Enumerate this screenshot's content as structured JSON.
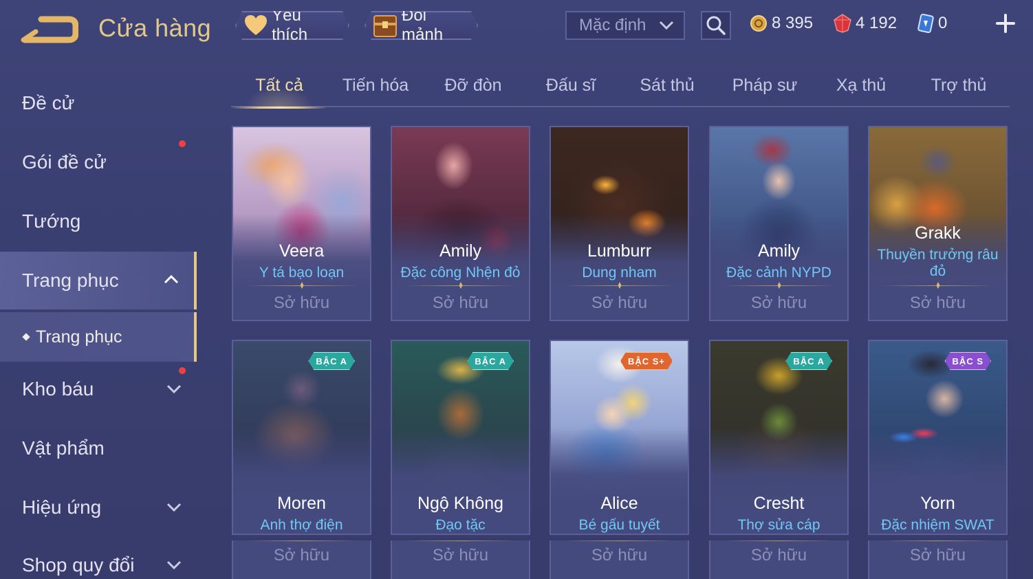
{
  "header": {
    "title": "Cửa hàng",
    "favorites_label": "Yêu thích",
    "exchange_label": "Đổi mảnh",
    "sort_selected": "Mặc định",
    "gold": "8 395",
    "gems": "4 192",
    "vouchers": "0"
  },
  "sidebar": {
    "items": [
      {
        "label": "Đề cử"
      },
      {
        "label": "Gói đề cử"
      },
      {
        "label": "Tướng"
      },
      {
        "label": "Trang phục"
      },
      {
        "label": "Kho báu"
      },
      {
        "label": "Vật phẩm"
      },
      {
        "label": "Hiệu ứng"
      },
      {
        "label": "Shop quy đổi"
      }
    ],
    "sub_item": "Trang phục"
  },
  "tabs": [
    "Tất cả",
    "Tiến hóa",
    "Đỡ đòn",
    "Đấu sĩ",
    "Sát thủ",
    "Pháp sư",
    "Xạ thủ",
    "Trợ thủ"
  ],
  "owned_label": "Sở hữu",
  "skins": [
    {
      "hero": "Veera",
      "skin": "Y tá bạo loạn",
      "badge": ""
    },
    {
      "hero": "Amily",
      "skin": "Đặc công Nhện đỏ",
      "badge": ""
    },
    {
      "hero": "Lumburr",
      "skin": "Dung nham",
      "badge": ""
    },
    {
      "hero": "Amily",
      "skin": "Đặc cảnh NYPD",
      "badge": ""
    },
    {
      "hero": "Grakk",
      "skin": "Thuyền trưởng râu đỏ",
      "badge": ""
    },
    {
      "hero": "Moren",
      "skin": "Anh thợ điện",
      "badge": "BẬC A"
    },
    {
      "hero": "Ngộ Không",
      "skin": "Đạo tặc",
      "badge": "BẬC A"
    },
    {
      "hero": "Alice",
      "skin": "Bé gấu tuyết",
      "badge": "BẬC S+"
    },
    {
      "hero": "Cresht",
      "skin": "Thợ sửa cáp",
      "badge": "BẬC A"
    },
    {
      "hero": "Yorn",
      "skin": "Đặc nhiệm SWAT",
      "badge": "BẬC S"
    }
  ],
  "colors": {
    "accent_gold": "#e3c889",
    "skin_name_blue": "#6fc8f5",
    "badge_a": "#2aa8a0",
    "badge_s_plus": "#e0662e",
    "badge_s": "#8a4fd0"
  }
}
